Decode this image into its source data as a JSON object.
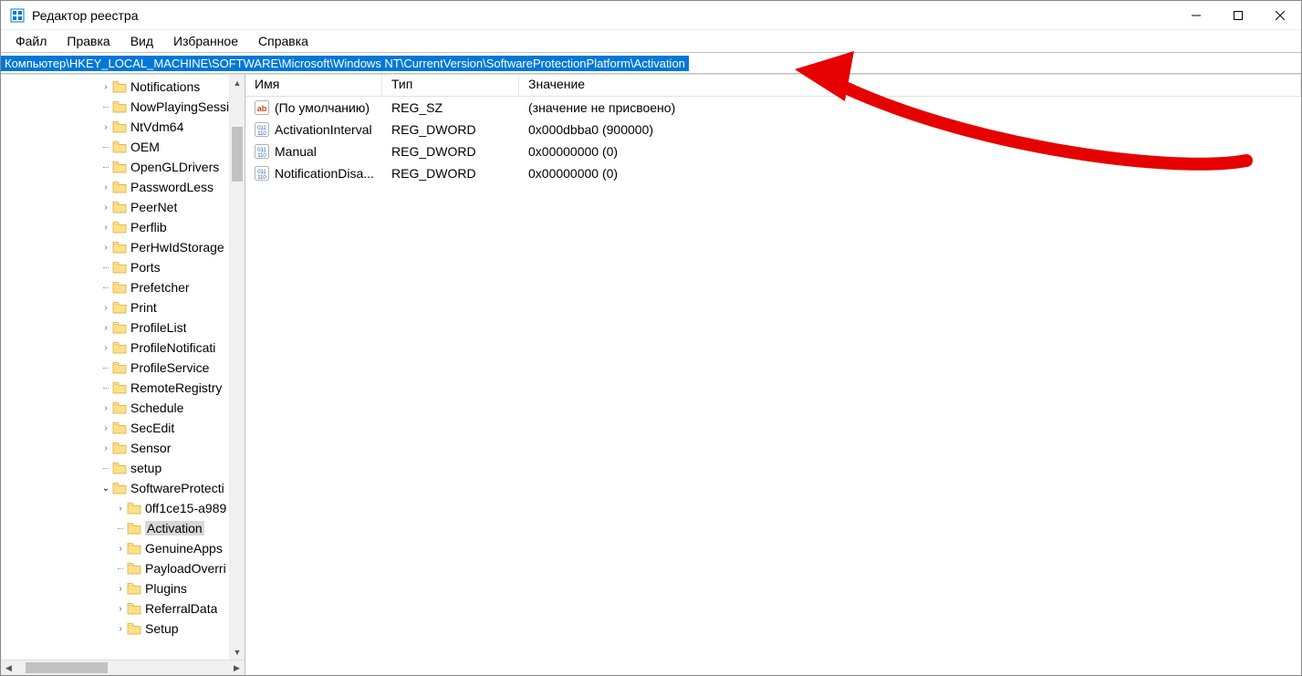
{
  "window": {
    "title": "Редактор реестра"
  },
  "menu": {
    "file": "Файл",
    "edit": "Правка",
    "view": "Вид",
    "favorites": "Избранное",
    "help": "Справка"
  },
  "address": {
    "path": "Компьютер\\HKEY_LOCAL_MACHINE\\SOFTWARE\\Microsoft\\Windows NT\\CurrentVersion\\SoftwareProtectionPlatform\\Activation"
  },
  "tree": {
    "items": [
      {
        "label": "Notifications",
        "indent": 3,
        "expander": "closed"
      },
      {
        "label": "NowPlayingSessi",
        "indent": 3,
        "expander": "none"
      },
      {
        "label": "NtVdm64",
        "indent": 3,
        "expander": "closed"
      },
      {
        "label": "OEM",
        "indent": 3,
        "expander": "none"
      },
      {
        "label": "OpenGLDrivers",
        "indent": 3,
        "expander": "none"
      },
      {
        "label": "PasswordLess",
        "indent": 3,
        "expander": "closed"
      },
      {
        "label": "PeerNet",
        "indent": 3,
        "expander": "closed"
      },
      {
        "label": "Perflib",
        "indent": 3,
        "expander": "closed"
      },
      {
        "label": "PerHwIdStorage",
        "indent": 3,
        "expander": "closed"
      },
      {
        "label": "Ports",
        "indent": 3,
        "expander": "none"
      },
      {
        "label": "Prefetcher",
        "indent": 3,
        "expander": "none"
      },
      {
        "label": "Print",
        "indent": 3,
        "expander": "closed"
      },
      {
        "label": "ProfileList",
        "indent": 3,
        "expander": "closed"
      },
      {
        "label": "ProfileNotificati",
        "indent": 3,
        "expander": "closed"
      },
      {
        "label": "ProfileService",
        "indent": 3,
        "expander": "none"
      },
      {
        "label": "RemoteRegistry",
        "indent": 3,
        "expander": "none"
      },
      {
        "label": "Schedule",
        "indent": 3,
        "expander": "closed"
      },
      {
        "label": "SecEdit",
        "indent": 3,
        "expander": "closed"
      },
      {
        "label": "Sensor",
        "indent": 3,
        "expander": "closed"
      },
      {
        "label": "setup",
        "indent": 3,
        "expander": "none"
      },
      {
        "label": "SoftwareProtecti",
        "indent": 3,
        "expander": "open"
      },
      {
        "label": "0ff1ce15-a989",
        "indent": 4,
        "expander": "closed"
      },
      {
        "label": "Activation",
        "indent": 4,
        "expander": "none",
        "selected": true
      },
      {
        "label": "GenuineApps",
        "indent": 4,
        "expander": "closed"
      },
      {
        "label": "PayloadOverri",
        "indent": 4,
        "expander": "none"
      },
      {
        "label": "Plugins",
        "indent": 4,
        "expander": "closed"
      },
      {
        "label": "ReferralData",
        "indent": 4,
        "expander": "closed"
      },
      {
        "label": "Setup",
        "indent": 4,
        "expander": "closed"
      }
    ]
  },
  "values": {
    "columns": {
      "name": "Имя",
      "type": "Тип",
      "data": "Значение"
    },
    "rows": [
      {
        "icon": "sz",
        "name": "(По умолчанию)",
        "type": "REG_SZ",
        "data": "(значение не присвоено)"
      },
      {
        "icon": "dword",
        "name": "ActivationInterval",
        "type": "REG_DWORD",
        "data": "0x000dbba0 (900000)"
      },
      {
        "icon": "dword",
        "name": "Manual",
        "type": "REG_DWORD",
        "data": "0x00000000 (0)"
      },
      {
        "icon": "dword",
        "name": "NotificationDisa...",
        "type": "REG_DWORD",
        "data": "0x00000000 (0)"
      }
    ]
  }
}
